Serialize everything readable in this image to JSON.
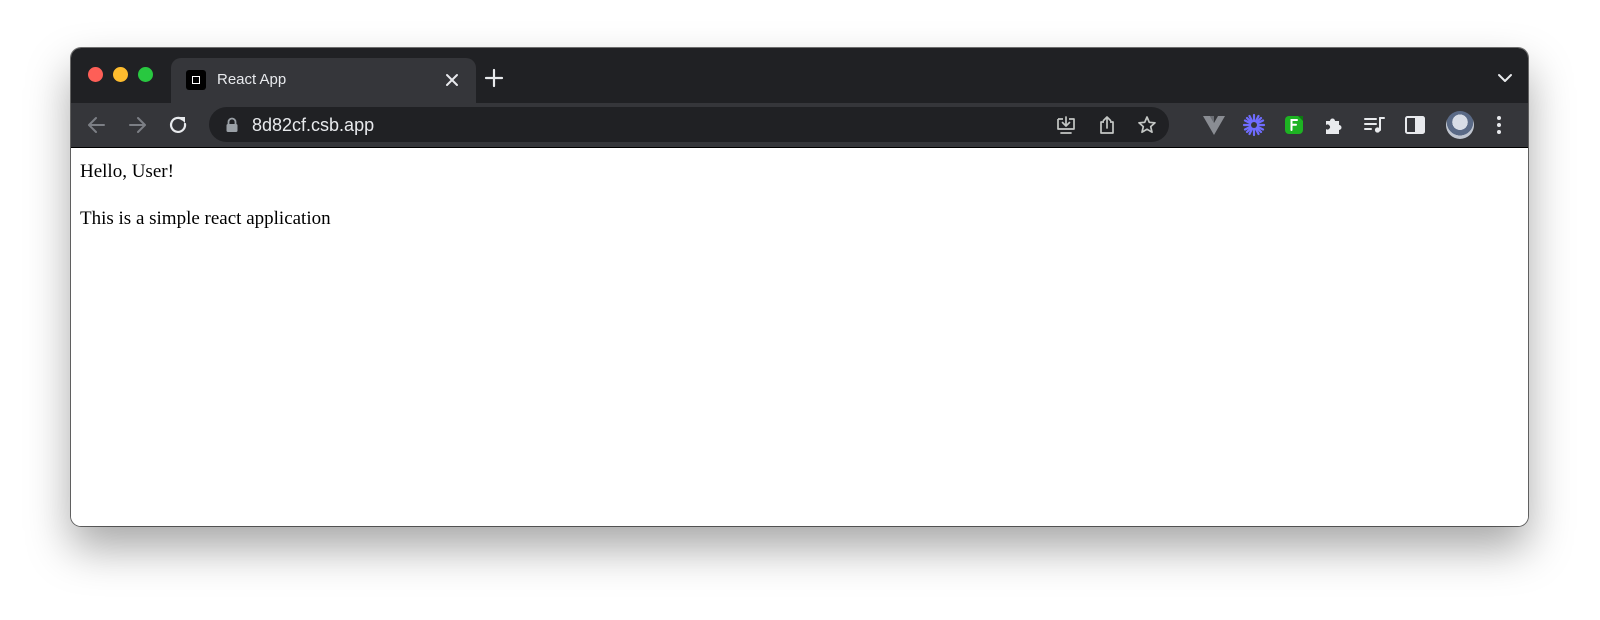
{
  "browser": {
    "tab": {
      "title": "React App"
    },
    "address_bar": {
      "url": "8d82cf.csb.app"
    },
    "toolbar_icons": [
      "back-arrow-icon",
      "forward-arrow-icon",
      "reload-icon",
      "lock-icon",
      "install-app-icon",
      "share-icon",
      "bookmark-star-icon",
      "vue-devtools-icon",
      "extension-sparkle-icon",
      "extension-f-icon",
      "puzzle-extensions-icon",
      "reading-list-icon",
      "side-panel-icon",
      "profile-avatar",
      "kebab-menu-icon"
    ],
    "colors": {
      "frame": "#202124",
      "toolbar": "#35363a",
      "tab_active": "#35363a",
      "text": "#e8eaed",
      "traffic_red": "#fe5f57",
      "traffic_yellow": "#febc2e",
      "traffic_green": "#28c840"
    }
  },
  "page": {
    "greeting": "Hello, User!",
    "description": "This is a simple react application"
  }
}
